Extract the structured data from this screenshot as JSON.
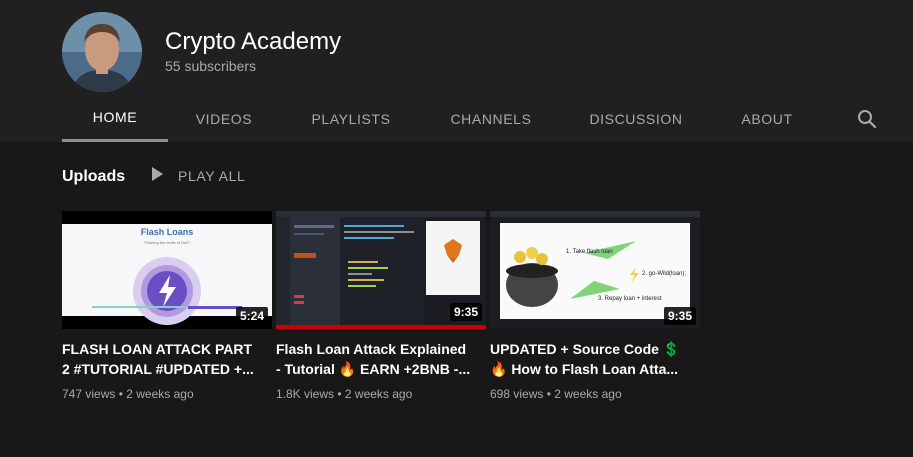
{
  "channel": {
    "name": "Crypto Academy",
    "subscribers": "55 subscribers"
  },
  "tabs": [
    "HOME",
    "VIDEOS",
    "PLAYLISTS",
    "CHANNELS",
    "DISCUSSION",
    "ABOUT"
  ],
  "active_tab": "HOME",
  "section": {
    "title": "Uploads",
    "play_all": "PLAY ALL"
  },
  "videos": [
    {
      "title_line1": "FLASH LOAN ATTACK PART",
      "title_line2": "2 #TUTORIAL #UPDATED +...",
      "duration": "5:24",
      "views": "747 views",
      "age": "2 weeks ago",
      "thumb_heading": "Flash Loans",
      "thumb_subheading": "Pushing the limits of DeFi"
    },
    {
      "title_line1": "Flash Loan Attack Explained",
      "title_line2": "- Tutorial 🔥 EARN +2BNB -...",
      "duration": "9:35",
      "views": "1.8K views",
      "age": "2 weeks ago",
      "watched": true
    },
    {
      "title_line1": "UPDATED + Source Code 💲",
      "title_line2": "🔥 How to Flash Loan Atta...",
      "duration": "9:35",
      "views": "698 views",
      "age": "2 weeks ago",
      "thumb_step1": "1. Take flash loan",
      "thumb_step2": "2. go-Wild(loan);",
      "thumb_step3": "3. Repay loan + interest"
    }
  ],
  "colors": {
    "background": "#181818",
    "header": "#202020",
    "progress": "#cc0000",
    "muted_text": "#aaaaaa"
  },
  "icons": [
    "search-icon",
    "play-icon"
  ]
}
